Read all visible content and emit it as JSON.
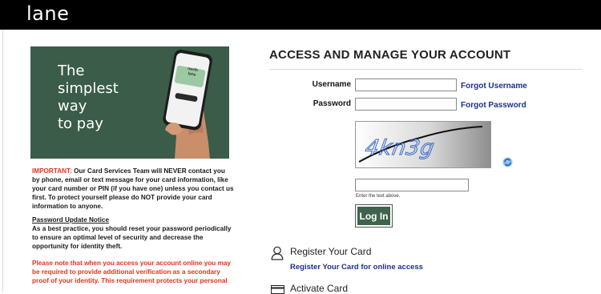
{
  "brand": "lane",
  "promo": {
    "headline": "The\nsimplest\nway\nto pay",
    "card_brand": "north\nlane"
  },
  "notice": {
    "important_label": "IMPORTANT:",
    "important_text": " Our Card Services Team will NEVER contact you by phone, email or text message for your card information, like your card number or PIN (if you have one) unless you contact us first. To protect yourself please do NOT provide your card information to anyone.",
    "password_heading": "Password Update Notice",
    "password_text": "As a best practice, you should reset your password periodically to ensure an optimal level of security and decrease the opportunity for identity theft.",
    "verification_text": "Please note that when you access your account online you may be required to provide additional verification as a secondary proof of your identity. This requirement protects your personal"
  },
  "form": {
    "title": "ACCESS AND MANAGE YOUR ACCOUNT",
    "username_label": "Username",
    "password_label": "Password",
    "forgot_username": "Forgot Username",
    "forgot_password": "Forgot Password",
    "captcha_text": "4kn3g",
    "captcha_hint": "Enter the text above.",
    "login_label": "Log In"
  },
  "register": {
    "title": "Register Your Card",
    "link": "Register Your Card for online access"
  },
  "activate": {
    "title": "Activate Card"
  },
  "colors": {
    "accent_green": "#3f634d",
    "promo_green": "#3a5c48",
    "link_blue": "#1f2f8a",
    "warning_red": "#e8321e"
  }
}
